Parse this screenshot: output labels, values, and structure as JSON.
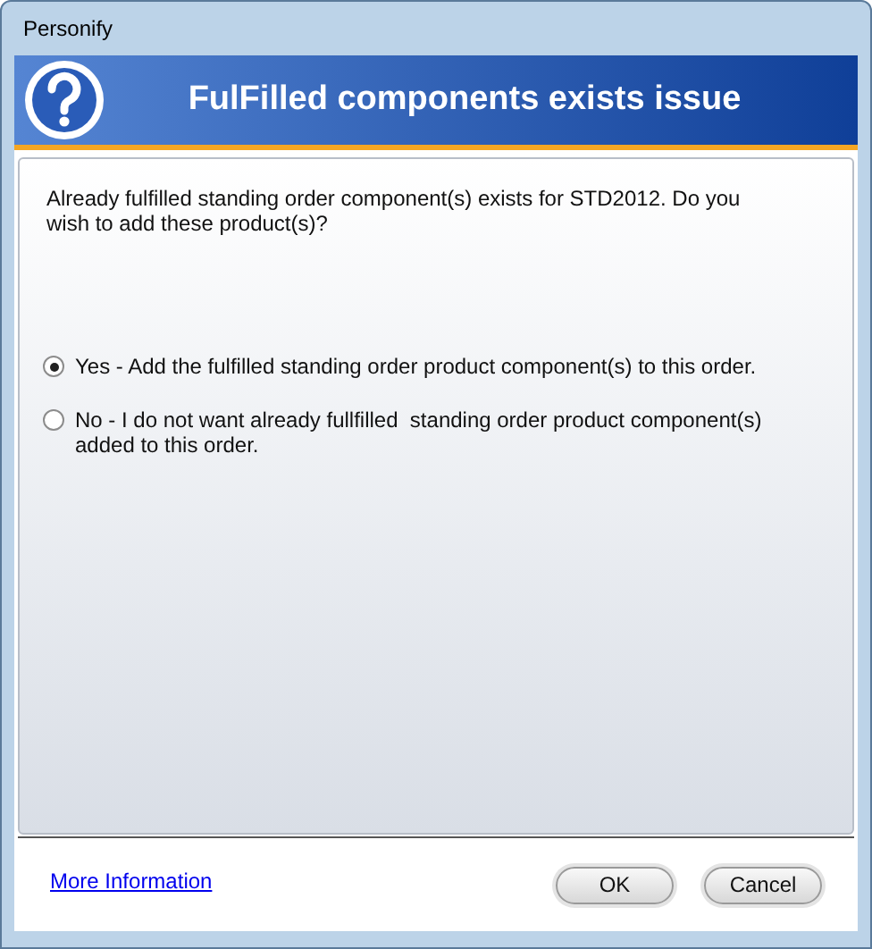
{
  "window": {
    "title": "Personify"
  },
  "header": {
    "title": "FulFilled components exists issue"
  },
  "message": "Already fulfilled standing order component(s) exists for STD2012. Do you wish to add these product(s)?",
  "options": [
    {
      "label": "Yes - Add the fulfilled standing order product component(s) to this order.",
      "selected": true
    },
    {
      "label": "No - I do not want already fullfilled  standing order product component(s) added to this order.",
      "selected": false
    }
  ],
  "link": "More Information",
  "buttons": [
    "OK",
    "Cancel"
  ]
}
